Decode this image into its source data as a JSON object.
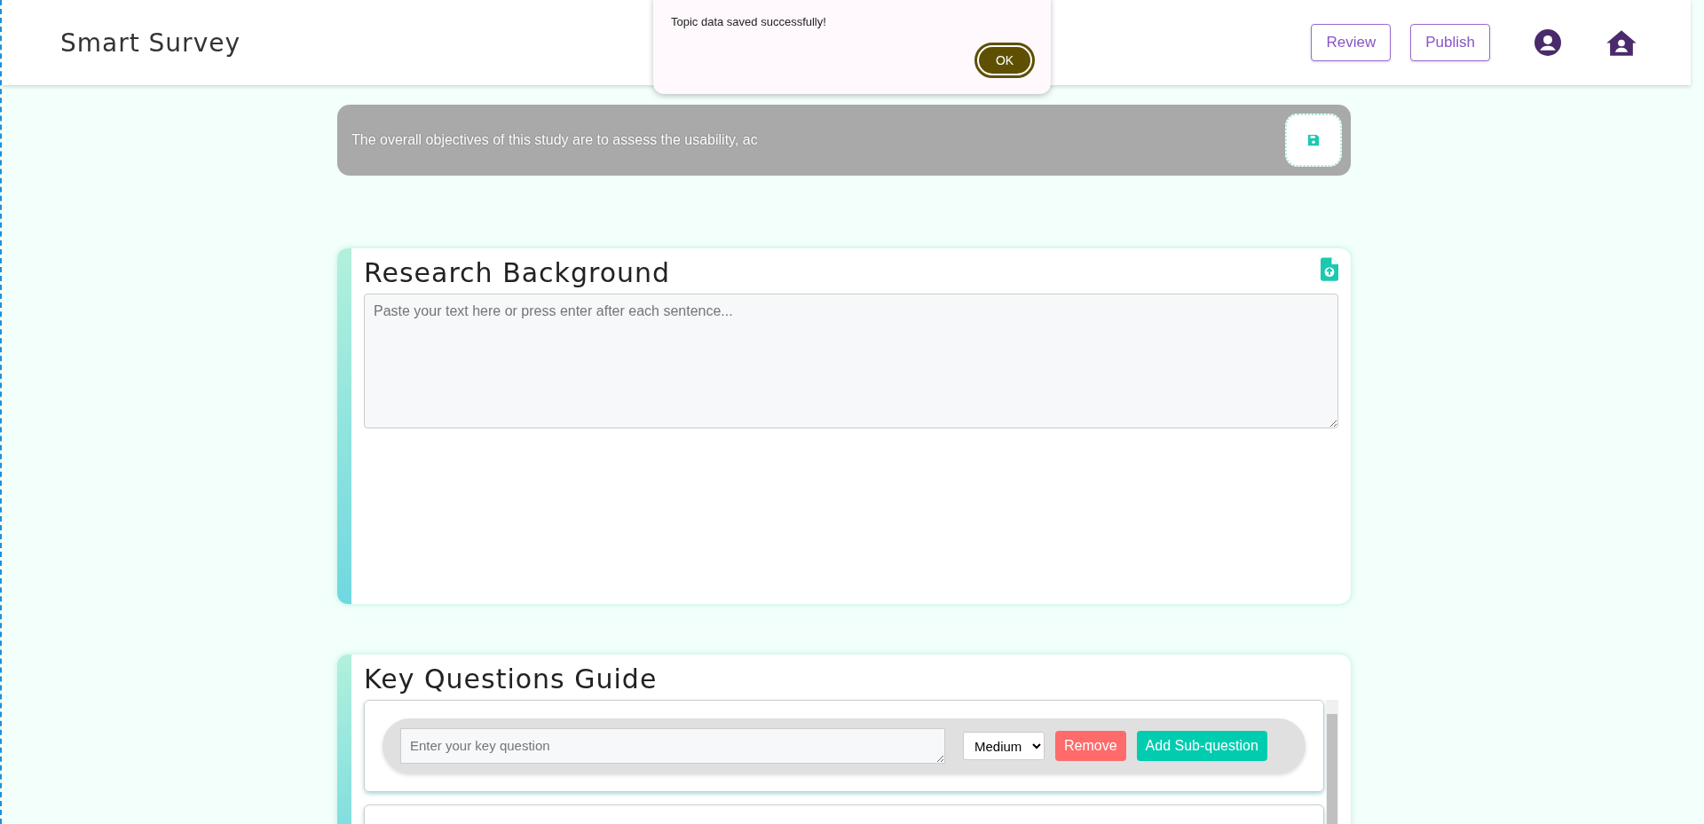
{
  "header": {
    "title": "Smart Survey",
    "buttons": [
      "Review",
      "Publish"
    ]
  },
  "dialog": {
    "message": "Topic data saved successfully!",
    "button": "OK"
  },
  "topic_bar": {
    "text": "The overall objectives of this study are to assess the usability, ac"
  },
  "research_background": {
    "title": "Research Background",
    "placeholder": "Paste your text here or press enter after each sentence..."
  },
  "key_questions": {
    "title": "Key Questions Guide",
    "questions": [
      {
        "placeholder": "Enter your key question",
        "priority": "Medium",
        "remove": "Remove",
        "add": "Add Sub-question"
      }
    ]
  }
}
